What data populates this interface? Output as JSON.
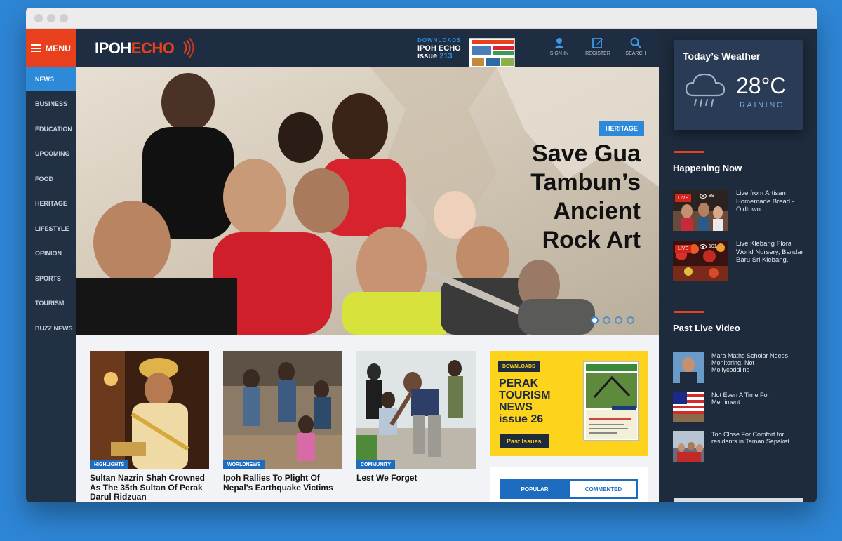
{
  "nav": {
    "menu_label": "MENU",
    "items": [
      "NEWS",
      "BUSINESS",
      "EDUCATION",
      "UPCOMING",
      "FOOD",
      "HERITAGE",
      "LIFESTYLE",
      "OPINION",
      "SPORTS",
      "TOURISM",
      "BUZZ NEWS"
    ],
    "active": "NEWS"
  },
  "header": {
    "logo_ipoh": "IPOH",
    "logo_echo": "ECHO",
    "downloads_label": "DOWNLOADS",
    "downloads_title": "IPOH ECHO",
    "downloads_issue_word": "issue",
    "downloads_issue_num": "213",
    "signin": "SIGN-IN",
    "register": "REGISTER",
    "search": "SEARCH"
  },
  "hero": {
    "tag": "HERITAGE",
    "title_lines": [
      "Save Gua",
      "Tambun’s",
      "Ancient",
      "Rock Art"
    ],
    "slide_count": 4,
    "active_slide": 1
  },
  "cards": [
    {
      "tag": "HIGHLIGHTS",
      "title": "Sultan Nazrin Shah Crowned As The 35th Sultan Of Perak Darul Ridzuan"
    },
    {
      "tag": "WORLDNEWS",
      "title": "Ipoh Rallies To Plight Of Nepal’s Earthquake Victims"
    },
    {
      "tag": "COMMUNITY",
      "title": "Lest We Forget"
    }
  ],
  "ad": {
    "badge": "DOWNLOADS",
    "title_lines": [
      "PERAK",
      "TOURISM",
      "NEWS"
    ],
    "issue": "issue 26",
    "button": "Past Issues"
  },
  "tabs": {
    "popular": "POPULAR",
    "commented": "COMMENTED"
  },
  "weather": {
    "title": "Today’s Weather",
    "temp": "28°C",
    "condition": "RAINING",
    "icon": "cloud-rain-icon"
  },
  "happening_now": {
    "title": "Happening Now",
    "items": [
      {
        "badge": "LIVE",
        "views": "89",
        "text": "Live from Artisan Homemade Bread - Oldtown"
      },
      {
        "badge": "LIVE",
        "views": "101",
        "text": "Live Klebang Flora World Nursery, Bandar Baru Sri Klebang."
      }
    ]
  },
  "past_live": {
    "title": "Past Live Video",
    "items": [
      {
        "text": "Mara Maths Scholar Needs Monitoring, Not Mollycoddling"
      },
      {
        "text": "Not Even A Time For Merriment"
      },
      {
        "text": "Too Close For Comfort for residents in Taman Sepakat"
      }
    ]
  },
  "colors": {
    "accent_red": "#e8401c",
    "accent_blue": "#2d8ad8",
    "navy": "#1e2b3d",
    "yellow": "#fdd31c"
  }
}
